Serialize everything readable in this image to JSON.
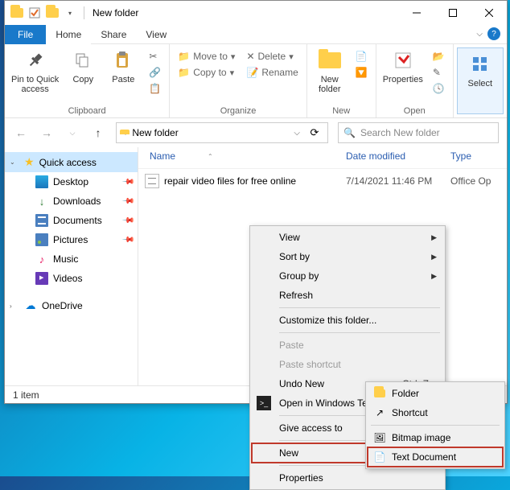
{
  "title": "New folder",
  "menubar": {
    "file": "File",
    "home": "Home",
    "share": "Share",
    "view": "View"
  },
  "ribbon": {
    "clipboard": {
      "pin": "Pin to Quick\naccess",
      "copy": "Copy",
      "paste": "Paste",
      "label": "Clipboard"
    },
    "organize": {
      "move": "Move to",
      "copyto": "Copy to",
      "delete": "Delete",
      "rename": "Rename",
      "label": "Organize"
    },
    "new": {
      "folder": "New\nfolder",
      "label": "New"
    },
    "open": {
      "properties": "Properties",
      "label": "Open"
    },
    "select": {
      "btn": "Select"
    }
  },
  "address": {
    "path": "New folder",
    "search_placeholder": "Search New folder"
  },
  "columns": {
    "name": "Name",
    "date": "Date modified",
    "type": "Type"
  },
  "files": [
    {
      "name": "repair video files for free online",
      "date": "7/14/2021 11:46 PM",
      "type": "Office Op"
    }
  ],
  "sidebar": {
    "quick": "Quick access",
    "items": [
      "Desktop",
      "Downloads",
      "Documents",
      "Pictures",
      "Music",
      "Videos"
    ],
    "onedrive": "OneDrive"
  },
  "status": {
    "count": "1 item"
  },
  "context": {
    "view": "View",
    "sort": "Sort by",
    "group": "Group by",
    "refresh": "Refresh",
    "customize": "Customize this folder...",
    "paste": "Paste",
    "paste_shortcut": "Paste shortcut",
    "undo": "Undo New",
    "undo_key": "Ctrl+Z",
    "terminal": "Open in Windows Terminal",
    "give": "Give access to",
    "new": "New",
    "properties": "Properties"
  },
  "context_sub": {
    "folder": "Folder",
    "shortcut": "Shortcut",
    "bitmap": "Bitmap image",
    "text": "Text Document"
  }
}
